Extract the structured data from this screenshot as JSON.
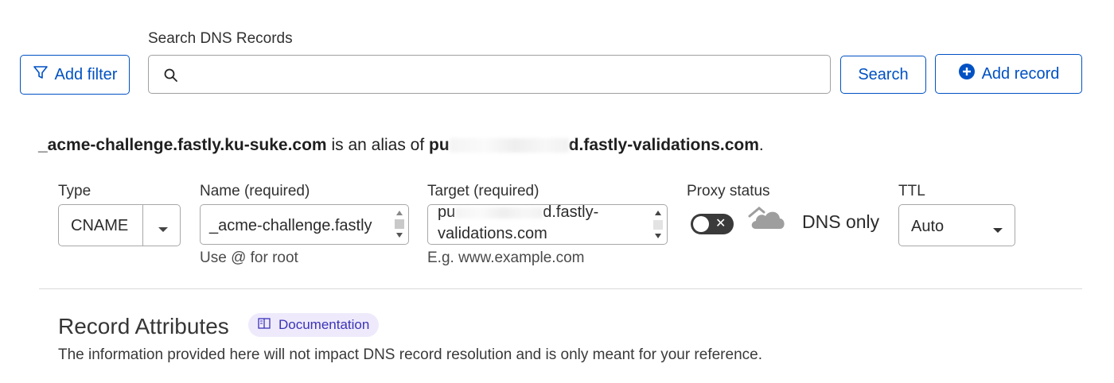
{
  "search": {
    "label": "Search DNS Records",
    "value": "",
    "placeholder": "",
    "add_filter_label": "Add filter",
    "search_button_label": "Search",
    "add_record_label": "Add record"
  },
  "alias": {
    "name": "_acme-challenge.fastly.ku-suke.com",
    "connector": " is an alias of ",
    "target_visible_start": "pu",
    "target_visible_end": "d.fastly-validations.com",
    "period": "."
  },
  "form": {
    "type_label": "Type",
    "type_value": "CNAME",
    "name_label": "Name (required)",
    "name_value": "_acme-challenge.fastly",
    "name_hint": "Use @ for root",
    "target_label": "Target (required)",
    "target_line1": "pu",
    "target_line1_end": "d.fastly-",
    "target_line2": "validations.com",
    "target_hint": "E.g. www.example.com",
    "proxy_label": "Proxy status",
    "proxy_state_text": "DNS only",
    "proxy_enabled": false,
    "ttl_label": "TTL",
    "ttl_value": "Auto"
  },
  "attributes": {
    "title": "Record Attributes",
    "doc_label": "Documentation",
    "description": "The information provided here will not impact DNS record resolution and is only meant for your reference."
  },
  "colors": {
    "accent": "#0051c3",
    "toggle_off": "#3a3a3a",
    "doc_pill_bg": "#eeeafc",
    "doc_pill_text": "#3b33b8"
  },
  "icons": {
    "filter": "filter-icon",
    "search": "search-icon",
    "add": "plus-circle-icon",
    "cloud": "cloud-icon",
    "book": "book-icon"
  }
}
